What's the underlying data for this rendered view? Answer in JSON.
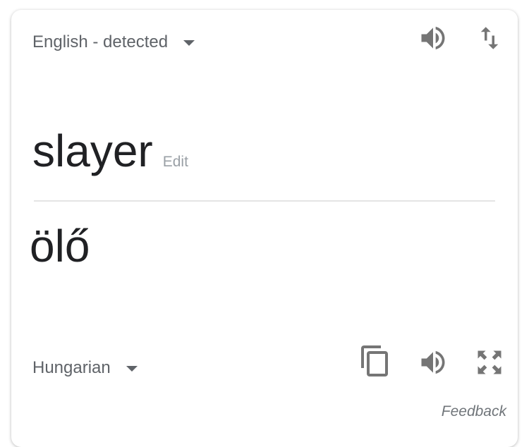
{
  "source": {
    "language_label": "English - detected",
    "text": "slayer",
    "edit_label": "Edit"
  },
  "target": {
    "language_label": "Hungarian",
    "text": "ölő"
  },
  "feedback_label": "Feedback",
  "icons": {
    "source_listen": "speaker-icon",
    "swap": "swap-languages-icon",
    "copy": "copy-icon",
    "target_listen": "speaker-icon",
    "fullscreen": "fullscreen-icon",
    "dropdown": "caret-down-icon"
  },
  "colors": {
    "icon": "#757575",
    "text_primary": "#202124",
    "text_secondary": "#5f6368",
    "divider": "#e4e4e4"
  }
}
